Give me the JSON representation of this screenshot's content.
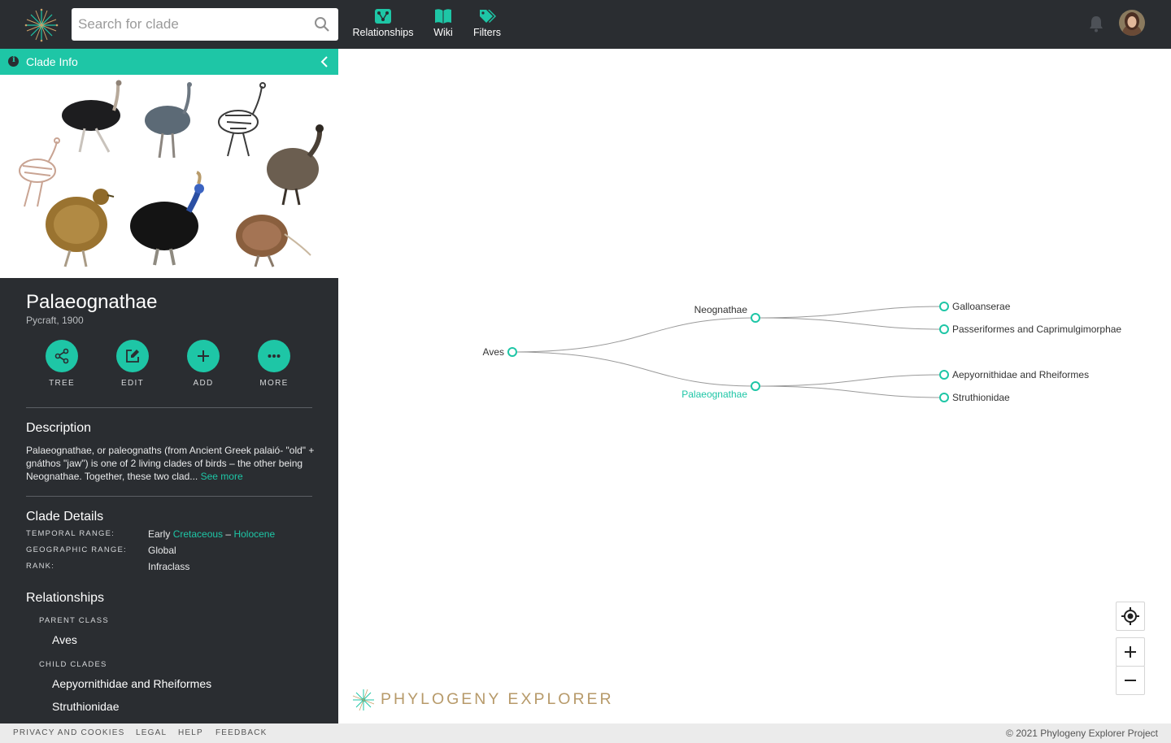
{
  "topbar": {
    "search": {
      "placeholder": "Search for clade",
      "value": ""
    },
    "nav": [
      {
        "label": "Relationships",
        "icon": "relationships-icon"
      },
      {
        "label": "Wiki",
        "icon": "book-icon"
      },
      {
        "label": "Filters",
        "icon": "tags-icon"
      }
    ],
    "icons": {
      "notifications": "bell-icon",
      "user": "user-avatar"
    }
  },
  "sidebar": {
    "header_title": "Clade Info",
    "clade_name": "Palaeognathae",
    "author": "Pycraft, 1900",
    "actions": [
      {
        "label": "TREE",
        "icon": "share-tree-icon"
      },
      {
        "label": "EDIT",
        "icon": "edit-icon"
      },
      {
        "label": "ADD",
        "icon": "plus-icon"
      },
      {
        "label": "MORE",
        "icon": "more-dots-icon"
      }
    ],
    "description": {
      "heading": "Description",
      "text": "Palaeognathae, or paleognaths (from Ancient Greek palaió- \"old\" + gnáthos \"jaw\") is one of 2 living clades of birds – the other being Neognathae. Together, these two clad...",
      "more_link": "See more"
    },
    "details": {
      "heading": "Clade Details",
      "temporal_label": "TEMPORAL RANGE:",
      "temporal_prefix": "Early",
      "temporal_from": "Cretaceous",
      "temporal_sep": "–",
      "temporal_to": "Holocene",
      "geo_label": "GEOGRAPHIC RANGE:",
      "geo_value": "Global",
      "rank_label": "RANK:",
      "rank_value": "Infraclass"
    },
    "relationships": {
      "heading": "Relationships",
      "parent_label": "PARENT CLASS",
      "parent": "Aves",
      "child_label": "CHILD CLADES",
      "children": [
        "Aepyornithidae and Rheiformes",
        "Struthionidae"
      ]
    }
  },
  "tree": {
    "nodes": [
      "Aves",
      "Neognathae",
      "Palaeognathae",
      "Galloanserae",
      "Passeriformes and Caprimulgimorphae",
      "Aepyornithidae and Rheiformes",
      "Struthionidae"
    ],
    "selected": "Palaeognathae",
    "controls": {
      "recenter": "crosshair-icon",
      "zoom_in": "plus-icon",
      "zoom_out": "minus-icon"
    },
    "brand": "PHYLOGENY EXPLORER"
  },
  "footer": {
    "links": [
      "PRIVACY AND COOKIES",
      "LEGAL",
      "HELP",
      "FEEDBACK"
    ],
    "copyright": "© 2021 Phylogeny Explorer Project"
  },
  "colors": {
    "accent": "#1ec6a6",
    "dark": "#2a2d31",
    "brand": "#b79a6a",
    "branch": "#9a9a9a"
  }
}
